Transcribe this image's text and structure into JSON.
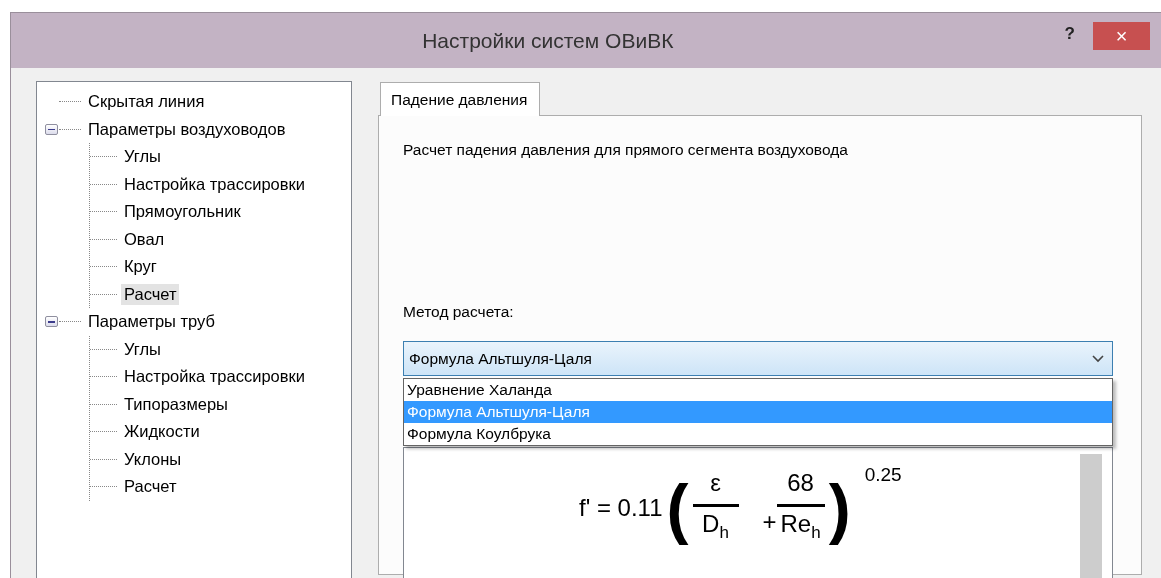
{
  "window": {
    "title": "Настройки систем ОВиВК",
    "help": "?",
    "close": "×"
  },
  "tree": [
    {
      "label": "Скрытая линия",
      "selected": false
    },
    {
      "label": "Параметры воздуховодов",
      "selected": false,
      "expanded": true,
      "children": [
        {
          "label": "Углы",
          "selected": false
        },
        {
          "label": "Настройка трассировки",
          "selected": false
        },
        {
          "label": "Прямоугольник",
          "selected": false
        },
        {
          "label": "Овал",
          "selected": false
        },
        {
          "label": "Круг",
          "selected": false
        },
        {
          "label": "Расчет",
          "selected": true
        }
      ]
    },
    {
      "label": "Параметры труб",
      "selected": false,
      "expanded": true,
      "children": [
        {
          "label": "Углы",
          "selected": false
        },
        {
          "label": "Настройка трассировки",
          "selected": false
        },
        {
          "label": "Типоразмеры",
          "selected": false
        },
        {
          "label": "Жидкости",
          "selected": false
        },
        {
          "label": "Уклоны",
          "selected": false
        },
        {
          "label": "Расчет",
          "selected": false
        }
      ]
    }
  ],
  "tabs": [
    {
      "label": "Падение давления",
      "selected": true
    }
  ],
  "description": "Расчет падения давления для прямого сегмента воздуховода",
  "method": {
    "label": "Метод расчета:",
    "value": "Формула Альтшуля-Цаля",
    "expanded": true,
    "options": [
      {
        "label": "Уравнение Халанда",
        "selected": false
      },
      {
        "label": "Формула Альтшуля-Цаля",
        "selected": true
      },
      {
        "label": "Формула Коулбрука",
        "selected": false
      }
    ]
  },
  "formula": {
    "lhs": "f' = 0.11",
    "open": "(",
    "term1_num": "ε",
    "term1_den": "D$_{h}$",
    "plus": "+",
    "term2_num": "68",
    "term2_den": "Re$_{h}$",
    "close": ")",
    "exponent": "0.25"
  }
}
